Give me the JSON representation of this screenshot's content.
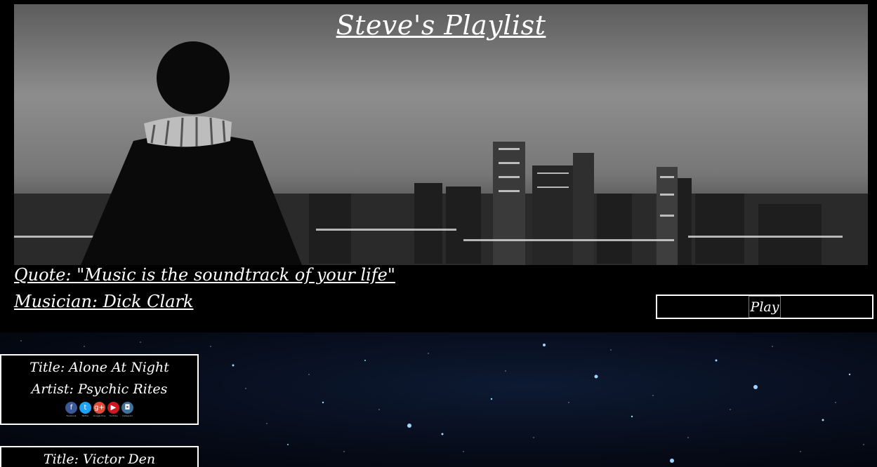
{
  "header": {
    "title": "Steve's Playlist"
  },
  "quote": {
    "quote_text": "Quote: \"Music is the soundtrack of your life\"",
    "musician_text": "Musician: Dick Clark"
  },
  "player": {
    "play_label": "Play"
  },
  "songs": [
    {
      "title": "Title: Alone At Night",
      "artist": "Artist: Psychic Rites",
      "social": [
        {
          "icon": "facebook-icon",
          "glyph": "f",
          "label": "Facebook",
          "color": "#3b5998"
        },
        {
          "icon": "twitter-icon",
          "glyph": "t",
          "label": "Twitter",
          "color": "#1da1f2"
        },
        {
          "icon": "google-plus-icon",
          "glyph": "g+",
          "label": "Google Plus",
          "color": "#dd4b39"
        },
        {
          "icon": "youtube-icon",
          "glyph": "▶",
          "label": "YouTube",
          "color": "#cc181e"
        },
        {
          "icon": "instagram-icon",
          "glyph": "◘",
          "label": "Instagram",
          "color": "#3f729b"
        }
      ]
    },
    {
      "title": "Title: Victor Den"
    }
  ],
  "colors": {
    "background": "#000000",
    "text": "#ffffff",
    "starfield": "#060b18"
  }
}
